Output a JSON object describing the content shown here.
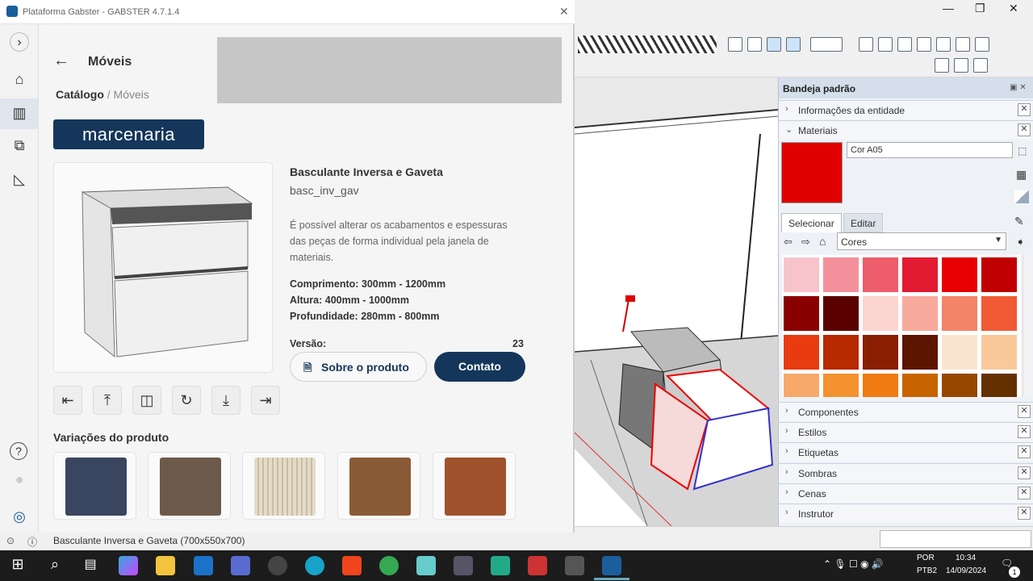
{
  "window": {
    "title": "Plataforma Gabster - GABSTER 4.7.1.4",
    "close": "✕"
  },
  "page": {
    "title": "Móveis",
    "breadcrumb_root": "Catálogo",
    "breadcrumb_rest": " / Móveis"
  },
  "brand": {
    "logo_text": "marcenaria",
    "color": "#14365a"
  },
  "product": {
    "name": "Basculante Inversa e Gaveta",
    "code": "basc_inv_gav",
    "description": "É possível alterar os acabamentos e espessuras das peças de forma individual pela janela de materiais.",
    "dims": {
      "comprimento": "Comprimento: 300mm - 1200mm",
      "altura": "Altura: 400mm - 1000mm",
      "profundidade": "Profundidade: 280mm - 800mm"
    },
    "version_label": "Versão:",
    "version": "23",
    "btn_about": "Sobre o produto",
    "btn_contact": "Contato"
  },
  "actions": [
    "align-left-icon",
    "align-top-icon",
    "center-icon",
    "rotate-icon",
    "align-bottom-icon",
    "align-right-icon"
  ],
  "variations": {
    "title": "Variações do produto"
  },
  "plugin_status": "Basculante Inversa e Gaveta (700x550x700)",
  "tray": {
    "title": "Bandeja padrão",
    "entity_info": "Informações da entidade",
    "materials": "Materiais",
    "material_name": "Cor A05",
    "tab_select": "Selecionar",
    "tab_edit": "Editar",
    "library": "Cores",
    "panels": [
      "Componentes",
      "Estilos",
      "Etiquetas",
      "Sombras",
      "Cenas",
      "Instrutor"
    ],
    "selected_color": "#e00000",
    "palette": [
      "#f7c4cc",
      "#f4909c",
      "#ee5d6b",
      "#e31b32",
      "#e60000",
      "#c00000",
      "#8a0000",
      "#5a0000",
      "#fcd5d0",
      "#f8aa9c",
      "#f38468",
      "#f05a35",
      "#e83b10",
      "#b82a00",
      "#8a1e00",
      "#5c1600",
      "#fbe4cf",
      "#f9c99a",
      "#f6a96a",
      "#f3922f",
      "#f07b12",
      "#c86400",
      "#964800",
      "#643000"
    ]
  },
  "taskbar": {
    "lang": "POR",
    "layout": "PTB2",
    "time": "10:34",
    "date": "14/09/2024",
    "notif": "1"
  }
}
